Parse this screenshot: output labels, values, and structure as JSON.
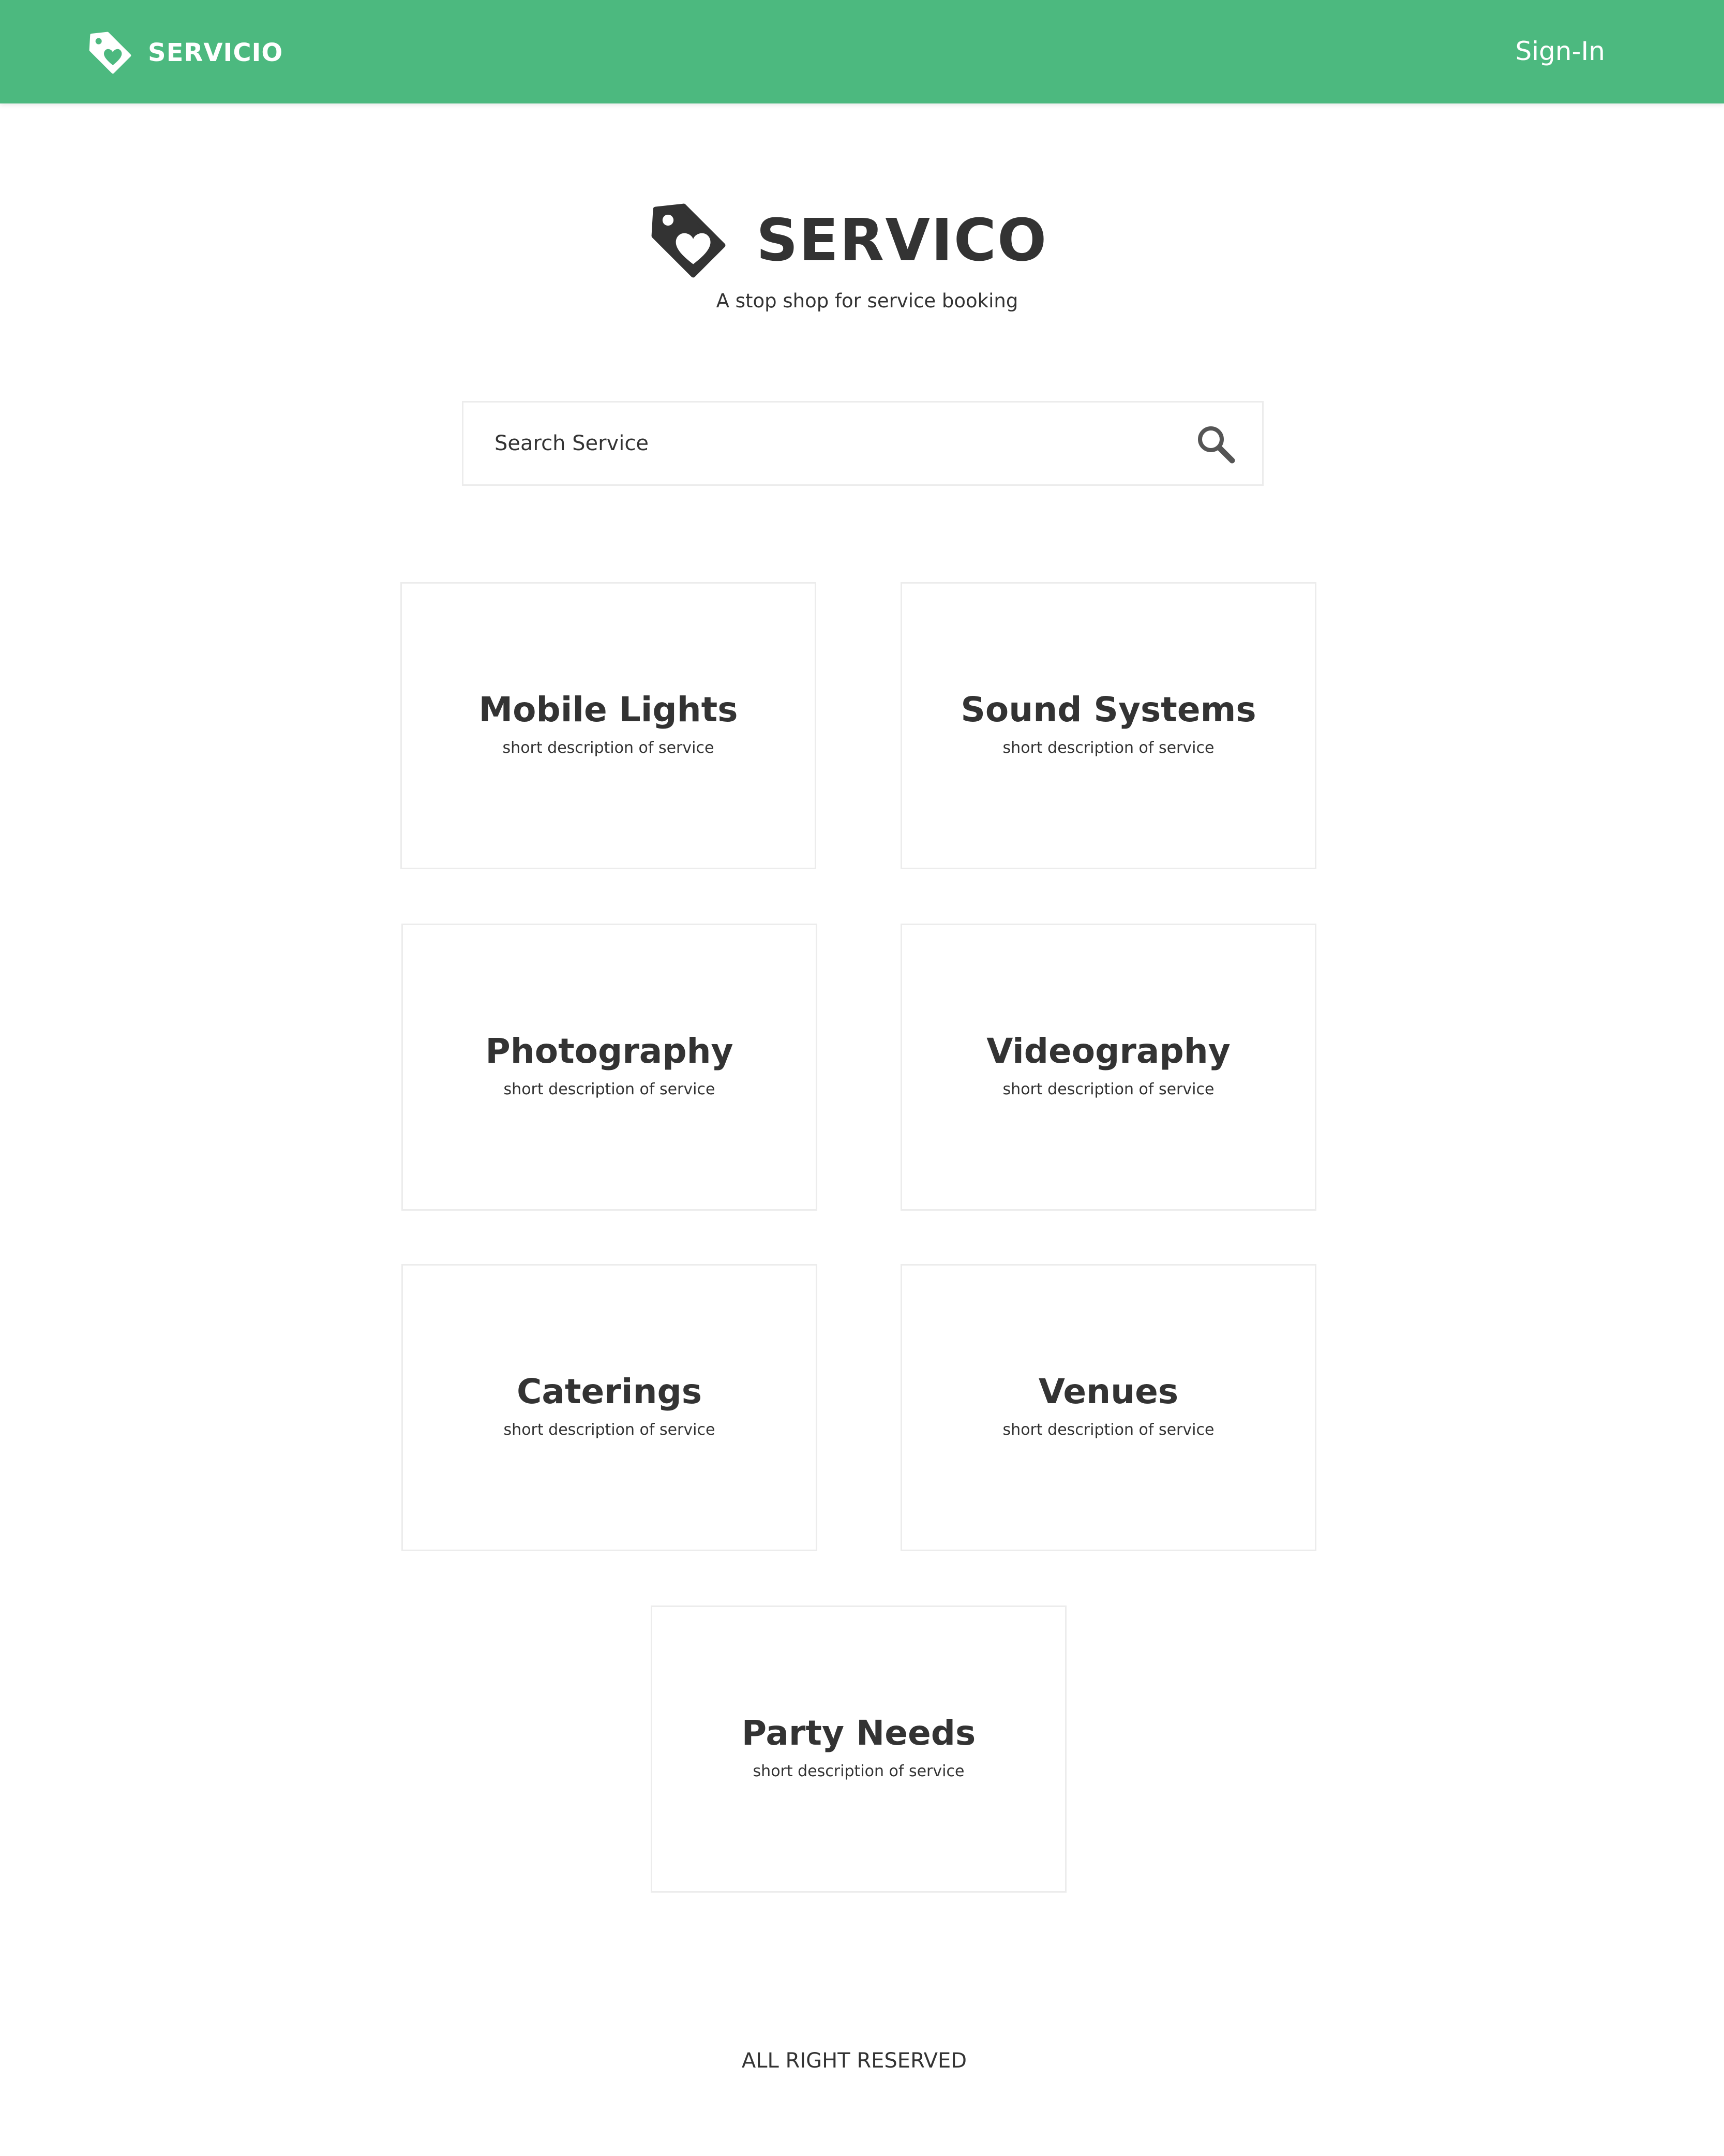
{
  "navbar": {
    "brand": "SERVICIO",
    "signin_label": "Sign-In",
    "background_color": "#4cb97f",
    "logo_icon": "heart-tag-icon"
  },
  "hero": {
    "title": "SERVICO",
    "tagline": "A stop shop for service booking",
    "logo_icon": "heart-tag-icon"
  },
  "search": {
    "placeholder": "Search Service",
    "icon": "search-icon"
  },
  "services": [
    {
      "title": "Mobile Lights",
      "description": "short description of service"
    },
    {
      "title": "Sound Systems",
      "description": "short description of service"
    },
    {
      "title": "Photography",
      "description": "short description of service"
    },
    {
      "title": "Videography",
      "description": "short description of service"
    },
    {
      "title": "Caterings",
      "description": "short description of service"
    },
    {
      "title": "Venues",
      "description": "short description of service"
    },
    {
      "title": "Party Needs",
      "description": "short description of service"
    }
  ],
  "footer": {
    "text": "ALL RIGHT RESERVED"
  }
}
